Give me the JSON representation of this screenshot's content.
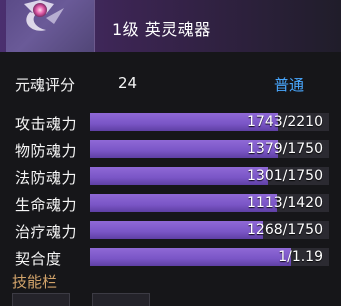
{
  "header": {
    "title": "1级 英灵魂器",
    "icon": "soul-vessel-icon"
  },
  "rating": {
    "label": "元魂评分",
    "value": "24",
    "grade": "普通",
    "grade_color": "#49a8ff"
  },
  "stats": [
    {
      "label": "攻击魂力",
      "text": "1743/2210",
      "current": 1743,
      "max": 2210
    },
    {
      "label": "物防魂力",
      "text": "1379/1750",
      "current": 1379,
      "max": 1750
    },
    {
      "label": "法防魂力",
      "text": "1301/1750",
      "current": 1301,
      "max": 1750
    },
    {
      "label": "生命魂力",
      "text": "1113/1420",
      "current": 1113,
      "max": 1420
    },
    {
      "label": "治疗魂力",
      "text": "1268/1750",
      "current": 1268,
      "max": 1750
    },
    {
      "label": "契合度",
      "text": "1/1.19",
      "current": 1,
      "max": 1.19
    }
  ],
  "skills": {
    "title": "技能栏",
    "title_color": "#d1a36a"
  },
  "colors": {
    "bar_fill": "#7a55c6",
    "bar_track": "#2b2a31",
    "background": "#161619"
  }
}
